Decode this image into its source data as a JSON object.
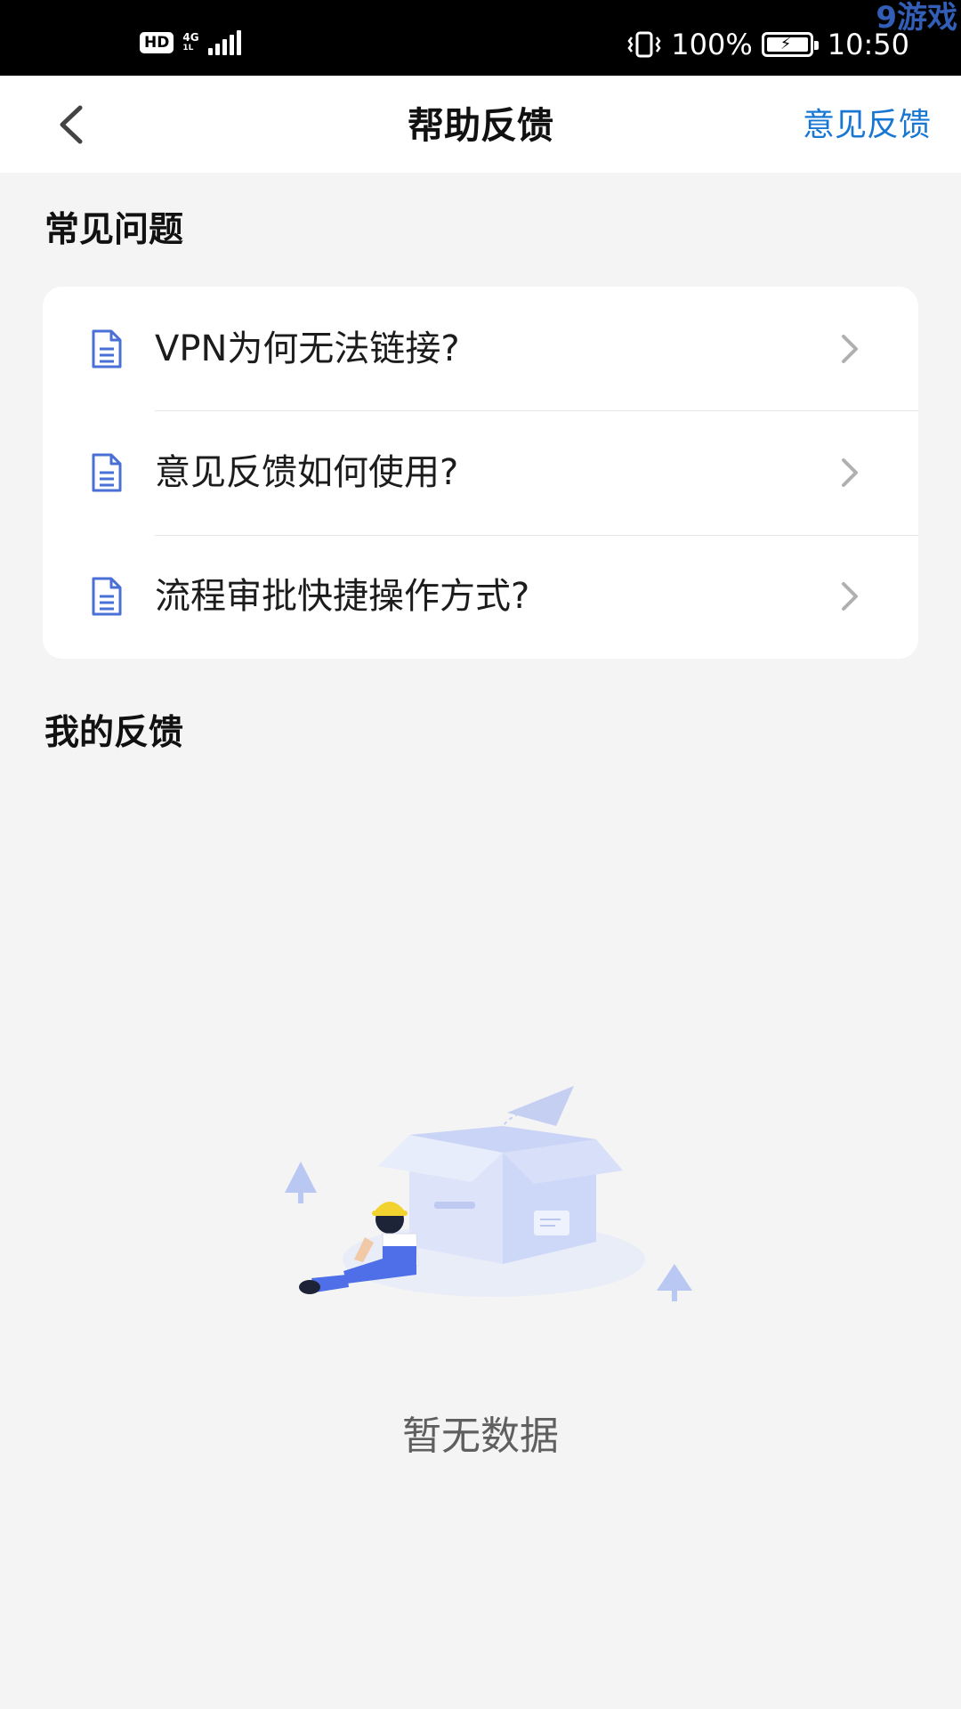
{
  "status_bar": {
    "hd": "HD",
    "network_top": "4G",
    "network_bottom": "1L",
    "battery_percent": "100%",
    "time": "10:50",
    "watermark": "9游戏"
  },
  "nav": {
    "title": "帮助反馈",
    "action": "意见反馈"
  },
  "faq": {
    "title": "常见问题",
    "items": [
      {
        "label": "VPN为何无法链接?"
      },
      {
        "label": "意见反馈如何使用?"
      },
      {
        "label": "流程审批快捷操作方式?"
      }
    ]
  },
  "my_feedback": {
    "title": "我的反馈",
    "empty_text": "暂无数据"
  },
  "colors": {
    "accent": "#1877d2",
    "icon": "#4a6fd6",
    "background": "#f4f4f4"
  }
}
